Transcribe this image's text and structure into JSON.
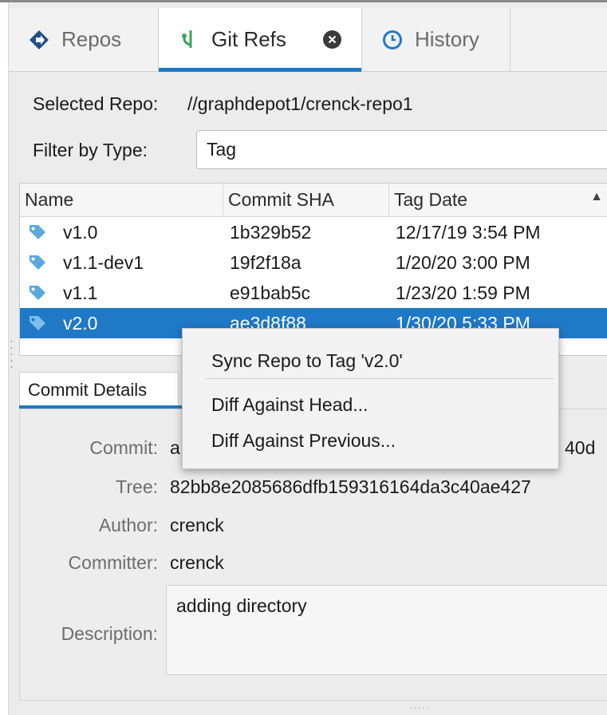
{
  "tabs": [
    {
      "label": "Repos",
      "icon": "diamond-arrow-icon"
    },
    {
      "label": "Git Refs",
      "icon": "git-branch-icon"
    },
    {
      "label": "History",
      "icon": "clock-icon"
    }
  ],
  "selected_repo": {
    "label": "Selected Repo:",
    "value": "//graphdepot1/crenck-repo1"
  },
  "filter": {
    "label": "Filter by Type:",
    "value": "Tag"
  },
  "table": {
    "columns": [
      "Name",
      "Commit SHA",
      "Tag Date"
    ],
    "rows": [
      {
        "name": "v1.0",
        "sha": "1b329b52",
        "date": "12/17/19 3:54 PM"
      },
      {
        "name": "v1.1-dev1",
        "sha": "19f2f18a",
        "date": "1/20/20 3:00 PM"
      },
      {
        "name": "v1.1",
        "sha": "e91bab5c",
        "date": "1/23/20 1:59 PM"
      },
      {
        "name": "v2.0",
        "sha": "ae3d8f88",
        "date": "1/30/20 5:33 PM"
      }
    ]
  },
  "details": {
    "tab_label": "Commit Details",
    "commit_label": "Commit:",
    "commit_value_start": "a",
    "commit_value_end": "40d",
    "tree_label": "Tree:",
    "tree_value": "82bb8e2085686dfb159316164da3c40ae427",
    "author_label": "Author:",
    "author_value": "crenck",
    "committer_label": "Committer:",
    "committer_value": "crenck",
    "description_label": "Description:",
    "description_value": "adding directory"
  },
  "context_menu": {
    "items": [
      "Sync Repo to Tag 'v2.0'",
      "Diff Against Head...",
      "Diff Against Previous..."
    ]
  },
  "colors": {
    "accent": "#1f79c7",
    "tag_icon": "#5aa9e0"
  }
}
